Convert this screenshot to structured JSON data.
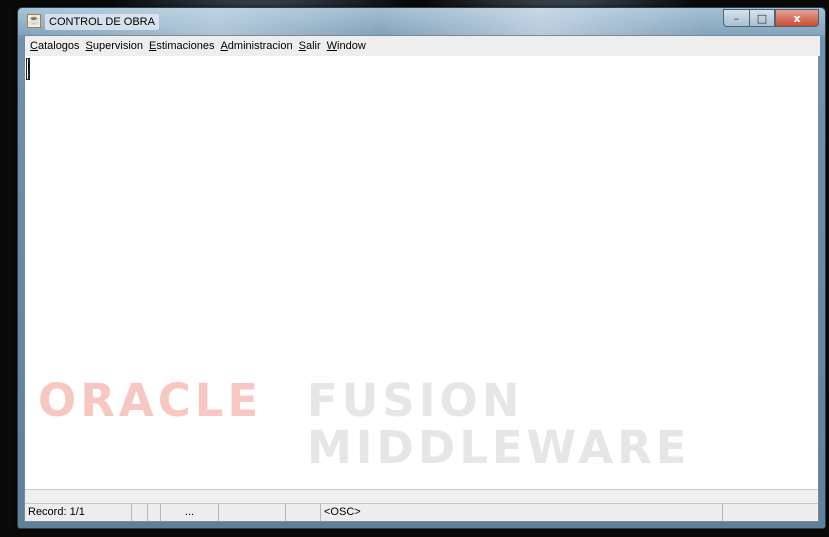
{
  "window": {
    "title": "CONTROL DE OBRA",
    "app_icon": "java-cup-icon"
  },
  "caption_buttons": {
    "minimize": "–",
    "maximize": "□",
    "close": "x"
  },
  "menu": {
    "items": [
      {
        "mnemonic": "C",
        "rest": "atalogos"
      },
      {
        "mnemonic": "S",
        "rest": "upervision"
      },
      {
        "mnemonic": "E",
        "rest": "stimaciones"
      },
      {
        "mnemonic": "A",
        "rest": "dministracion"
      },
      {
        "mnemonic": "S",
        "rest": "alir"
      },
      {
        "mnemonic": "W",
        "rest": "indow"
      }
    ]
  },
  "watermark": {
    "oracle": "ORACLE",
    "fusion": "FUSION",
    "middleware": "MIDDLEWARE"
  },
  "status": {
    "record": "Record: 1/1",
    "ellipsis": "...",
    "mode": "<OSC>"
  }
}
